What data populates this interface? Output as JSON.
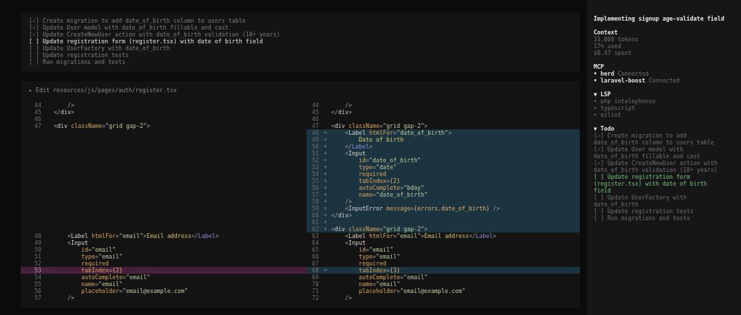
{
  "plan": {
    "todos": [
      {
        "box": "[✓]",
        "text": "Create migration to add date_of_birth column to users table",
        "active": false
      },
      {
        "box": "[✓]",
        "text": "Update User model with date_of_birth fillable and cast",
        "active": false
      },
      {
        "box": "[✓]",
        "text": "Update CreateNewUser action with date_of_birth validation (18+ years)",
        "active": false
      },
      {
        "box": "[ ]",
        "text": "Update registration form (register.tsx) with date of birth field",
        "active": true
      },
      {
        "box": "[ ]",
        "text": "Update UserFactory with date_of_birth",
        "active": false
      },
      {
        "box": "[ ]",
        "text": "Update registration tests",
        "active": false
      },
      {
        "box": "[ ]",
        "text": "Run migrations and tests",
        "active": false
      }
    ]
  },
  "diff": {
    "toggle": "▸",
    "title": "Edit resources/js/pages/auth/register.tsx",
    "rows": [
      {
        "left": {
          "number": "44",
          "kind": "context",
          "tokens": [
            {
              "kind": "pl",
              "text": "    />"
            }
          ]
        },
        "right": {
          "number": "44",
          "kind": "context",
          "tokens": [
            {
              "kind": "pl",
              "text": "    />"
            }
          ]
        }
      },
      {
        "left": {
          "number": "45",
          "kind": "context",
          "tokens": [
            {
              "kind": "pl",
              "text": "</"
            },
            {
              "kind": "tag",
              "text": "div"
            },
            {
              "kind": "pl",
              "text": ">"
            }
          ]
        },
        "right": {
          "number": "45",
          "kind": "context",
          "tokens": [
            {
              "kind": "pl",
              "text": "</"
            },
            {
              "kind": "tag",
              "text": "div"
            },
            {
              "kind": "pl",
              "text": ">"
            }
          ]
        }
      },
      {
        "left": {
          "number": "46",
          "kind": "context"
        },
        "right": {
          "number": "46",
          "kind": "context"
        }
      },
      {
        "left": {
          "number": "47",
          "kind": "context",
          "tokens": [
            {
              "kind": "pl",
              "text": "<"
            },
            {
              "kind": "tag",
              "text": "div"
            },
            {
              "kind": "attr",
              "text": " className"
            },
            {
              "kind": "pl",
              "text": "="
            },
            {
              "kind": "str",
              "text": "\"grid gap-2\""
            },
            {
              "kind": "pl",
              "text": ">"
            }
          ]
        },
        "right": {
          "number": "47",
          "kind": "context",
          "tokens": [
            {
              "kind": "pl",
              "text": "<"
            },
            {
              "kind": "tag",
              "text": "div"
            },
            {
              "kind": "attr",
              "text": " className"
            },
            {
              "kind": "pl",
              "text": "="
            },
            {
              "kind": "str",
              "text": "\"grid gap-2\""
            },
            {
              "kind": "pl",
              "text": ">"
            }
          ]
        }
      },
      {
        "right": {
          "number": "48",
          "kind": "added",
          "marker": "+",
          "tokens": [
            {
              "kind": "pl",
              "text": "    <"
            },
            {
              "kind": "tag",
              "text": "Label"
            },
            {
              "kind": "attr",
              "text": " htmlFor"
            },
            {
              "kind": "pl",
              "text": "="
            },
            {
              "kind": "str",
              "text": "\"date_of_birth\""
            },
            {
              "kind": "pl",
              "text": ">"
            }
          ]
        }
      },
      {
        "right": {
          "number": "49",
          "kind": "added",
          "marker": "+",
          "tokens": [
            {
              "kind": "txt",
              "text": "        Date of birth"
            }
          ]
        }
      },
      {
        "right": {
          "number": "50",
          "kind": "added",
          "marker": "+",
          "tokens": [
            {
              "kind": "pl",
              "text": "    </"
            },
            {
              "kind": "comp",
              "text": "Label"
            },
            {
              "kind": "pl",
              "text": ">"
            }
          ]
        }
      },
      {
        "right": {
          "number": "51",
          "kind": "added",
          "marker": "+",
          "tokens": [
            {
              "kind": "pl",
              "text": "    <"
            },
            {
              "kind": "tag",
              "text": "Input"
            }
          ]
        }
      },
      {
        "right": {
          "number": "52",
          "kind": "added",
          "marker": "+",
          "tokens": [
            {
              "kind": "attr",
              "text": "        id"
            },
            {
              "kind": "pl",
              "text": "="
            },
            {
              "kind": "str",
              "text": "\"date_of_birth\""
            }
          ]
        }
      },
      {
        "right": {
          "number": "53",
          "kind": "added",
          "marker": "+",
          "tokens": [
            {
              "kind": "attr",
              "text": "        type"
            },
            {
              "kind": "pl",
              "text": "="
            },
            {
              "kind": "str",
              "text": "\"date\""
            }
          ]
        }
      },
      {
        "right": {
          "number": "54",
          "kind": "added",
          "marker": "+",
          "tokens": [
            {
              "kind": "attr",
              "text": "        required"
            }
          ]
        }
      },
      {
        "right": {
          "number": "55",
          "kind": "added",
          "marker": "+",
          "tokens": [
            {
              "kind": "attr",
              "text": "        tabIndex"
            },
            {
              "kind": "pl",
              "text": "="
            },
            {
              "kind": "num",
              "text": "{2}"
            }
          ]
        }
      },
      {
        "right": {
          "number": "56",
          "kind": "added",
          "marker": "+",
          "tokens": [
            {
              "kind": "attr",
              "text": "        autoComplete"
            },
            {
              "kind": "pl",
              "text": "="
            },
            {
              "kind": "str",
              "text": "\"bday\""
            }
          ]
        }
      },
      {
        "right": {
          "number": "57",
          "kind": "added",
          "marker": "+",
          "tokens": [
            {
              "kind": "attr",
              "text": "        name"
            },
            {
              "kind": "pl",
              "text": "="
            },
            {
              "kind": "str",
              "text": "\"date_of_birth\""
            }
          ]
        }
      },
      {
        "right": {
          "number": "58",
          "kind": "added",
          "marker": "+",
          "tokens": [
            {
              "kind": "pl",
              "text": "    />"
            }
          ]
        }
      },
      {
        "right": {
          "number": "59",
          "kind": "added",
          "marker": "+",
          "tokens": [
            {
              "kind": "pl",
              "text": "    <"
            },
            {
              "kind": "tag",
              "text": "InputError"
            },
            {
              "kind": "attr",
              "text": " message"
            },
            {
              "kind": "pl",
              "text": "="
            },
            {
              "kind": "num",
              "text": "{errors.date_of_birth}"
            },
            {
              "kind": "pl",
              "text": " />"
            }
          ]
        }
      },
      {
        "right": {
          "number": "60",
          "kind": "added",
          "marker": "+",
          "tokens": [
            {
              "kind": "pl",
              "text": "</"
            },
            {
              "kind": "tag",
              "text": "div"
            },
            {
              "kind": "pl",
              "text": ">"
            }
          ]
        }
      },
      {
        "right": {
          "number": "61",
          "kind": "added",
          "marker": "+"
        }
      },
      {
        "right": {
          "number": "62",
          "kind": "added",
          "marker": "+",
          "tokens": [
            {
              "kind": "pl",
              "text": "<"
            },
            {
              "kind": "tag",
              "text": "div"
            },
            {
              "kind": "attr",
              "text": " className"
            },
            {
              "kind": "pl",
              "text": "="
            },
            {
              "kind": "str",
              "text": "\"grid gap-2\""
            },
            {
              "kind": "pl",
              "text": ">"
            }
          ]
        }
      },
      {
        "left": {
          "number": "48",
          "kind": "context",
          "tokens": [
            {
              "kind": "pl",
              "text": "    <"
            },
            {
              "kind": "tag",
              "text": "Label"
            },
            {
              "kind": "attr",
              "text": " htmlFor"
            },
            {
              "kind": "pl",
              "text": "="
            },
            {
              "kind": "str",
              "text": "\"email\""
            },
            {
              "kind": "pl",
              "text": ">"
            },
            {
              "kind": "txt",
              "text": "Email address"
            },
            {
              "kind": "pl",
              "text": "</"
            },
            {
              "kind": "comp",
              "text": "Label"
            },
            {
              "kind": "pl",
              "text": ">"
            }
          ]
        },
        "right": {
          "number": "63",
          "kind": "context",
          "tokens": [
            {
              "kind": "pl",
              "text": "    <"
            },
            {
              "kind": "tag",
              "text": "Label"
            },
            {
              "kind": "attr",
              "text": " htmlFor"
            },
            {
              "kind": "pl",
              "text": "="
            },
            {
              "kind": "str",
              "text": "\"email\""
            },
            {
              "kind": "pl",
              "text": ">"
            },
            {
              "kind": "txt",
              "text": "Email address"
            },
            {
              "kind": "pl",
              "text": "</"
            },
            {
              "kind": "comp",
              "text": "Label"
            },
            {
              "kind": "pl",
              "text": ">"
            }
          ]
        }
      },
      {
        "left": {
          "number": "49",
          "kind": "context",
          "tokens": [
            {
              "kind": "pl",
              "text": "    <"
            },
            {
              "kind": "tag",
              "text": "Input"
            }
          ]
        },
        "right": {
          "number": "64",
          "kind": "context",
          "tokens": [
            {
              "kind": "pl",
              "text": "    <"
            },
            {
              "kind": "tag",
              "text": "Input"
            }
          ]
        }
      },
      {
        "left": {
          "number": "50",
          "kind": "context",
          "tokens": [
            {
              "kind": "attr",
              "text": "        id"
            },
            {
              "kind": "pl",
              "text": "="
            },
            {
              "kind": "str",
              "text": "\"email\""
            }
          ]
        },
        "right": {
          "number": "65",
          "kind": "context",
          "tokens": [
            {
              "kind": "attr",
              "text": "        id"
            },
            {
              "kind": "pl",
              "text": "="
            },
            {
              "kind": "str",
              "text": "\"email\""
            }
          ]
        }
      },
      {
        "left": {
          "number": "51",
          "kind": "context",
          "tokens": [
            {
              "kind": "attr",
              "text": "        type"
            },
            {
              "kind": "pl",
              "text": "="
            },
            {
              "kind": "str",
              "text": "\"email\""
            }
          ]
        },
        "right": {
          "number": "66",
          "kind": "context",
          "tokens": [
            {
              "kind": "attr",
              "text": "        type"
            },
            {
              "kind": "pl",
              "text": "="
            },
            {
              "kind": "str",
              "text": "\"email\""
            }
          ]
        }
      },
      {
        "left": {
          "number": "52",
          "kind": "context",
          "tokens": [
            {
              "kind": "attr",
              "text": "        required"
            }
          ]
        },
        "right": {
          "number": "67",
          "kind": "context",
          "tokens": [
            {
              "kind": "attr",
              "text": "        required"
            }
          ]
        }
      },
      {
        "left": {
          "number": "53",
          "kind": "removed",
          "marker": "-",
          "tokens": [
            {
              "kind": "attr",
              "text": "        tabIndex"
            },
            {
              "kind": "pl",
              "text": "="
            },
            {
              "kind": "num",
              "text": "{2}"
            }
          ]
        },
        "right": {
          "number": "68",
          "kind": "added",
          "marker": "+",
          "tokens": [
            {
              "kind": "attr",
              "text": "        tabIndex"
            },
            {
              "kind": "pl",
              "text": "="
            },
            {
              "kind": "num",
              "text": "{3}"
            }
          ]
        }
      },
      {
        "left": {
          "number": "54",
          "kind": "context",
          "tokens": [
            {
              "kind": "attr",
              "text": "        autoComplete"
            },
            {
              "kind": "pl",
              "text": "="
            },
            {
              "kind": "str",
              "text": "\"email\""
            }
          ]
        },
        "right": {
          "number": "69",
          "kind": "context",
          "tokens": [
            {
              "kind": "attr",
              "text": "        autoComplete"
            },
            {
              "kind": "pl",
              "text": "="
            },
            {
              "kind": "str",
              "text": "\"email\""
            }
          ]
        }
      },
      {
        "left": {
          "number": "55",
          "kind": "context",
          "tokens": [
            {
              "kind": "attr",
              "text": "        name"
            },
            {
              "kind": "pl",
              "text": "="
            },
            {
              "kind": "str",
              "text": "\"email\""
            }
          ]
        },
        "right": {
          "number": "70",
          "kind": "context",
          "tokens": [
            {
              "kind": "attr",
              "text": "        name"
            },
            {
              "kind": "pl",
              "text": "="
            },
            {
              "kind": "str",
              "text": "\"email\""
            }
          ]
        }
      },
      {
        "left": {
          "number": "56",
          "kind": "context",
          "tokens": [
            {
              "kind": "attr",
              "text": "        placeholder"
            },
            {
              "kind": "pl",
              "text": "="
            },
            {
              "kind": "str",
              "text": "\"email@example.com\""
            }
          ]
        },
        "right": {
          "number": "71",
          "kind": "context",
          "tokens": [
            {
              "kind": "attr",
              "text": "        placeholder"
            },
            {
              "kind": "pl",
              "text": "="
            },
            {
              "kind": "str",
              "text": "\"email@example.com\""
            }
          ]
        }
      },
      {
        "left": {
          "number": "57",
          "kind": "context",
          "tokens": [
            {
              "kind": "pl",
              "text": "    />"
            }
          ]
        },
        "right": {
          "number": "72",
          "kind": "context",
          "tokens": [
            {
              "kind": "pl",
              "text": "    />"
            }
          ]
        }
      }
    ]
  },
  "sidebar": {
    "title": "Implementing signup age-validate field",
    "context": {
      "heading": "Context",
      "lines": [
        "33,000 tokens",
        "17% used",
        "$0.47 spent"
      ]
    },
    "mcp": {
      "heading": "MCP",
      "servers": [
        {
          "name": "• herd",
          "status": "Connected"
        },
        {
          "name": "• laravel-boost",
          "status": "Connected"
        }
      ]
    },
    "lsp": {
      "heading": "▼ LSP",
      "items": [
        "• php intelephense",
        "• typescript",
        "• eslint"
      ]
    },
    "todo": {
      "heading": "▼ Todo",
      "items": [
        {
          "box": "[✓]",
          "text": "Create migration to add date_of_birth column to users table",
          "active": false
        },
        {
          "box": "[✓]",
          "text": "Update User model with date_of_birth fillable and cast",
          "active": false
        },
        {
          "box": "[✓]",
          "text": "Update CreateNewUser action with date_of_birth validation (18+ years)",
          "active": false
        },
        {
          "box": "[ ]",
          "text": "Update registration form (register.tsx) with date of birth field",
          "active": true
        },
        {
          "box": "[ ]",
          "text": "Update UserFactory with date_of_birth",
          "active": false
        },
        {
          "box": "[ ]",
          "text": "Update registration tests",
          "active": false
        },
        {
          "box": "[ ]",
          "text": "Run migrations and tests",
          "active": false
        }
      ]
    }
  }
}
